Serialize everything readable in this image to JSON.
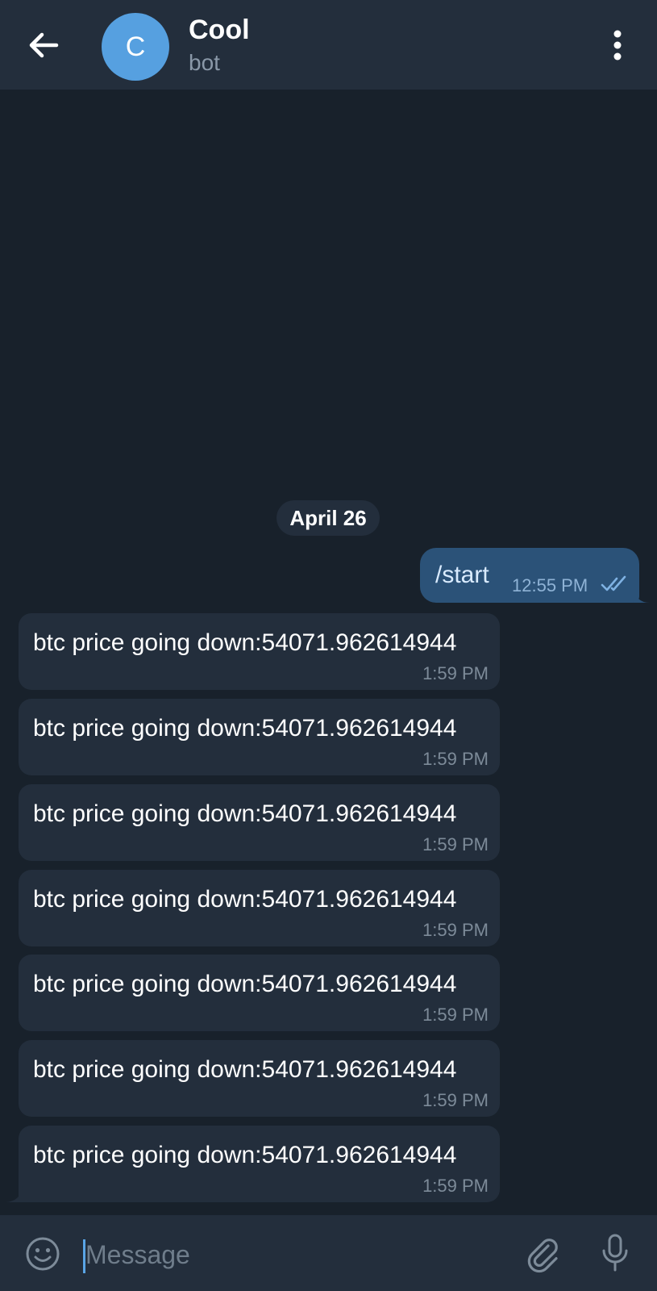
{
  "header": {
    "avatar_letter": "C",
    "title": "Cool",
    "subtitle": "bot",
    "icons": {
      "back": "arrow-left-icon",
      "menu": "more-vertical-icon"
    }
  },
  "date_separator": "April 26",
  "outgoing": {
    "text": "/start",
    "time": "12:55 PM",
    "status_icon": "double-check-icon"
  },
  "messages": [
    {
      "text": "btc price going down:54071.962614944",
      "time": "1:59 PM"
    },
    {
      "text": "btc price going down:54071.962614944",
      "time": "1:59 PM"
    },
    {
      "text": "btc price going down:54071.962614944",
      "time": "1:59 PM"
    },
    {
      "text": "btc price going down:54071.962614944",
      "time": "1:59 PM"
    },
    {
      "text": "btc price going down:54071.962614944",
      "time": "1:59 PM"
    },
    {
      "text": "btc price going down:54071.962614944",
      "time": "1:59 PM"
    },
    {
      "text": "btc price going down:54071.962614944",
      "time": "1:59 PM"
    }
  ],
  "input": {
    "placeholder": "Message",
    "icons": {
      "emoji": "emoji-icon",
      "attach": "paperclip-icon",
      "mic": "microphone-icon"
    }
  },
  "colors": {
    "background": "#18212b",
    "header": "#232e3c",
    "incoming_bubble": "#232e3c",
    "outgoing_bubble": "#2b5278",
    "avatar": "#56a0e0",
    "accent": "#5aa5e6"
  }
}
